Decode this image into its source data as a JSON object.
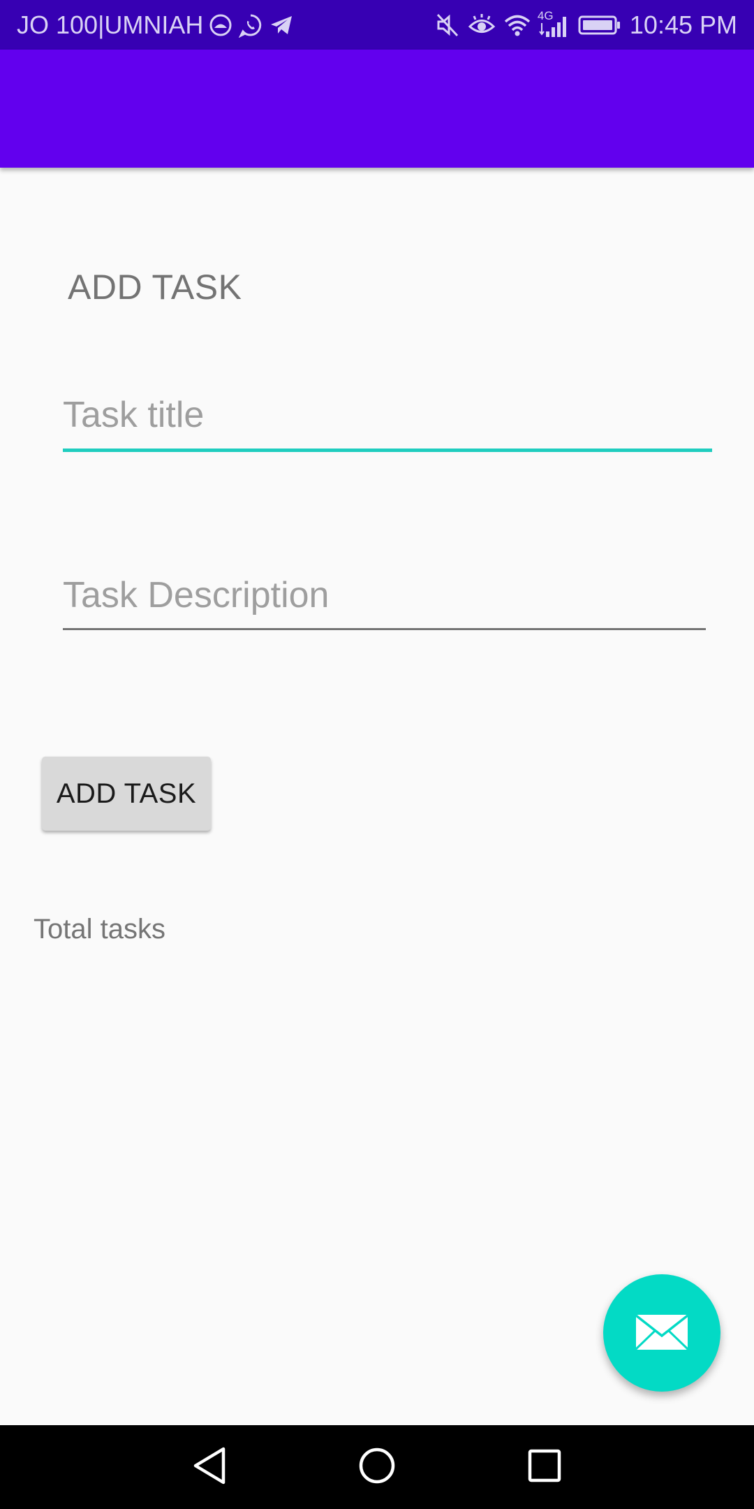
{
  "status_bar": {
    "carrier": "JO 100|UMNIAH",
    "network": "4G",
    "time": "10:45 PM",
    "notification_icons": [
      "umniah-icon",
      "whatsapp-icon",
      "telegram-icon"
    ],
    "system_icons": [
      "mute-icon",
      "eye-comfort-icon",
      "wifi-icon",
      "signal-icon",
      "battery-icon"
    ]
  },
  "app_bar": {
    "color": "#6200ee"
  },
  "form": {
    "heading": "ADD TASK",
    "title_placeholder": "Task title",
    "title_value": "",
    "description_placeholder": "Task Description",
    "description_value": "",
    "add_button_label": "ADD TASK",
    "total_tasks_label": "Total tasks"
  },
  "fab": {
    "icon": "email-icon",
    "color": "#03dac5"
  },
  "nav_bar": {
    "buttons": [
      "back-icon",
      "home-icon",
      "recents-icon"
    ]
  },
  "colors": {
    "status_bar": "#3700b3",
    "primary": "#6200ee",
    "accent": "#03dac5",
    "field_focus": "#1fcdbf",
    "background": "#fafafa"
  }
}
